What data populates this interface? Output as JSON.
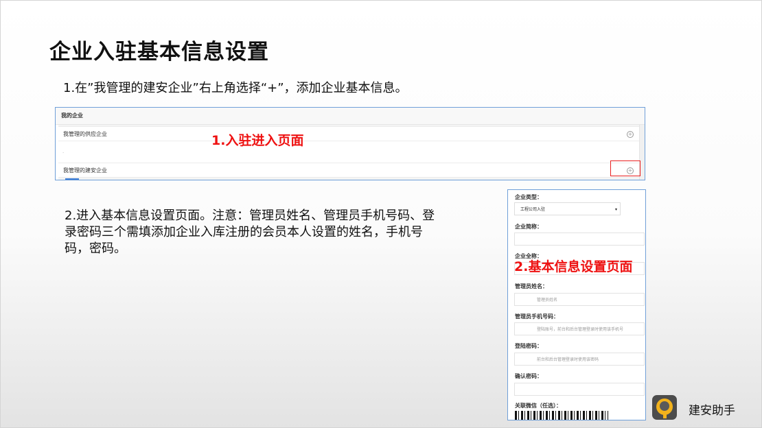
{
  "slide": {
    "title": "企业入驻基本信息设置",
    "step1_text": "1.在”我管理的建安企业”右上角选择“+”，添加企业基本信息。",
    "step2_text": "2.进入基本信息设置页面。注意：管理员姓名、管理员手机号码、登录密码三个需填添加企业入库注册的会员本人设置的姓名，手机号码，密码。"
  },
  "screenshot1": {
    "header": "我的企业",
    "row1_label": "我管理的供应企业",
    "blank_dot": ".",
    "row2_label": "我管理的建安企业",
    "plus_glyph": "+",
    "annotation": "1.入驻进入页面"
  },
  "screenshot2": {
    "type_label": "企业类型：",
    "type_value": "工程公司入驻",
    "type_caret": "▾",
    "short_name_label": "企业简称：",
    "full_name_label": "企业全称：",
    "admin_name_label": "管理员姓名：",
    "admin_name_placeholder": "管理员姓名",
    "admin_phone_label": "管理员手机号码：",
    "admin_phone_placeholder": "登陆账号，前台和后台管理登录时使用该手机号",
    "password_label": "登陆密码：",
    "password_placeholder": "前台和后台管理登录时使用该密码",
    "confirm_label": "确认密码：",
    "wechat_label": "关联微信（任选）：",
    "annotation": "2.基本信息设置页面"
  },
  "brand": {
    "name": "建安助手",
    "accent_color": "#f2b21c",
    "annotation_color": "#ee1111"
  }
}
